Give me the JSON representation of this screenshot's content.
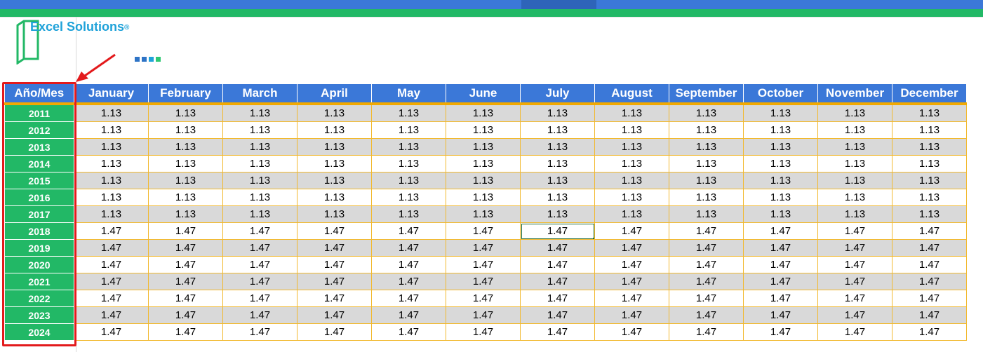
{
  "logo": {
    "brand": "Excel Solutions",
    "registered": "®",
    "squares": [
      "#2e74c6",
      "#2e74c6",
      "#1fa2d9",
      "#2fc873"
    ],
    "colors": {
      "frame": "#22b866",
      "text": "#1fa2d9"
    }
  },
  "table": {
    "corner_label": "Año/Mes",
    "months": [
      "January",
      "February",
      "March",
      "April",
      "May",
      "June",
      "July",
      "August",
      "September",
      "October",
      "November",
      "December"
    ],
    "rows": [
      {
        "year": "2011",
        "values": [
          "1.13",
          "1.13",
          "1.13",
          "1.13",
          "1.13",
          "1.13",
          "1.13",
          "1.13",
          "1.13",
          "1.13",
          "1.13",
          "1.13"
        ]
      },
      {
        "year": "2012",
        "values": [
          "1.13",
          "1.13",
          "1.13",
          "1.13",
          "1.13",
          "1.13",
          "1.13",
          "1.13",
          "1.13",
          "1.13",
          "1.13",
          "1.13"
        ]
      },
      {
        "year": "2013",
        "values": [
          "1.13",
          "1.13",
          "1.13",
          "1.13",
          "1.13",
          "1.13",
          "1.13",
          "1.13",
          "1.13",
          "1.13",
          "1.13",
          "1.13"
        ]
      },
      {
        "year": "2014",
        "values": [
          "1.13",
          "1.13",
          "1.13",
          "1.13",
          "1.13",
          "1.13",
          "1.13",
          "1.13",
          "1.13",
          "1.13",
          "1.13",
          "1.13"
        ]
      },
      {
        "year": "2015",
        "values": [
          "1.13",
          "1.13",
          "1.13",
          "1.13",
          "1.13",
          "1.13",
          "1.13",
          "1.13",
          "1.13",
          "1.13",
          "1.13",
          "1.13"
        ]
      },
      {
        "year": "2016",
        "values": [
          "1.13",
          "1.13",
          "1.13",
          "1.13",
          "1.13",
          "1.13",
          "1.13",
          "1.13",
          "1.13",
          "1.13",
          "1.13",
          "1.13"
        ]
      },
      {
        "year": "2017",
        "values": [
          "1.13",
          "1.13",
          "1.13",
          "1.13",
          "1.13",
          "1.13",
          "1.13",
          "1.13",
          "1.13",
          "1.13",
          "1.13",
          "1.13"
        ]
      },
      {
        "year": "2018",
        "values": [
          "1.47",
          "1.47",
          "1.47",
          "1.47",
          "1.47",
          "1.47",
          "1.47",
          "1.47",
          "1.47",
          "1.47",
          "1.47",
          "1.47"
        ]
      },
      {
        "year": "2019",
        "values": [
          "1.47",
          "1.47",
          "1.47",
          "1.47",
          "1.47",
          "1.47",
          "1.47",
          "1.47",
          "1.47",
          "1.47",
          "1.47",
          "1.47"
        ]
      },
      {
        "year": "2020",
        "values": [
          "1.47",
          "1.47",
          "1.47",
          "1.47",
          "1.47",
          "1.47",
          "1.47",
          "1.47",
          "1.47",
          "1.47",
          "1.47",
          "1.47"
        ]
      },
      {
        "year": "2021",
        "values": [
          "1.47",
          "1.47",
          "1.47",
          "1.47",
          "1.47",
          "1.47",
          "1.47",
          "1.47",
          "1.47",
          "1.47",
          "1.47",
          "1.47"
        ]
      },
      {
        "year": "2022",
        "values": [
          "1.47",
          "1.47",
          "1.47",
          "1.47",
          "1.47",
          "1.47",
          "1.47",
          "1.47",
          "1.47",
          "1.47",
          "1.47",
          "1.47"
        ]
      },
      {
        "year": "2023",
        "values": [
          "1.47",
          "1.47",
          "1.47",
          "1.47",
          "1.47",
          "1.47",
          "1.47",
          "1.47",
          "1.47",
          "1.47",
          "1.47",
          "1.47"
        ]
      },
      {
        "year": "2024",
        "values": [
          "1.47",
          "1.47",
          "1.47",
          "1.47",
          "1.47",
          "1.47",
          "1.47",
          "1.47",
          "1.47",
          "1.47",
          "1.47",
          "1.47"
        ]
      }
    ],
    "active_cell": {
      "year": "2018",
      "month": "July"
    },
    "colors": {
      "header_bg": "#3b78d8",
      "header_accent": "#f2a900",
      "year_bg": "#22b866",
      "stripe": "#d9d9d9",
      "cell_border": "#f2b92e"
    }
  },
  "annotation": {
    "highlight_target": "year-column",
    "color": "#e31a1c",
    "icon": "arrow-icon"
  }
}
